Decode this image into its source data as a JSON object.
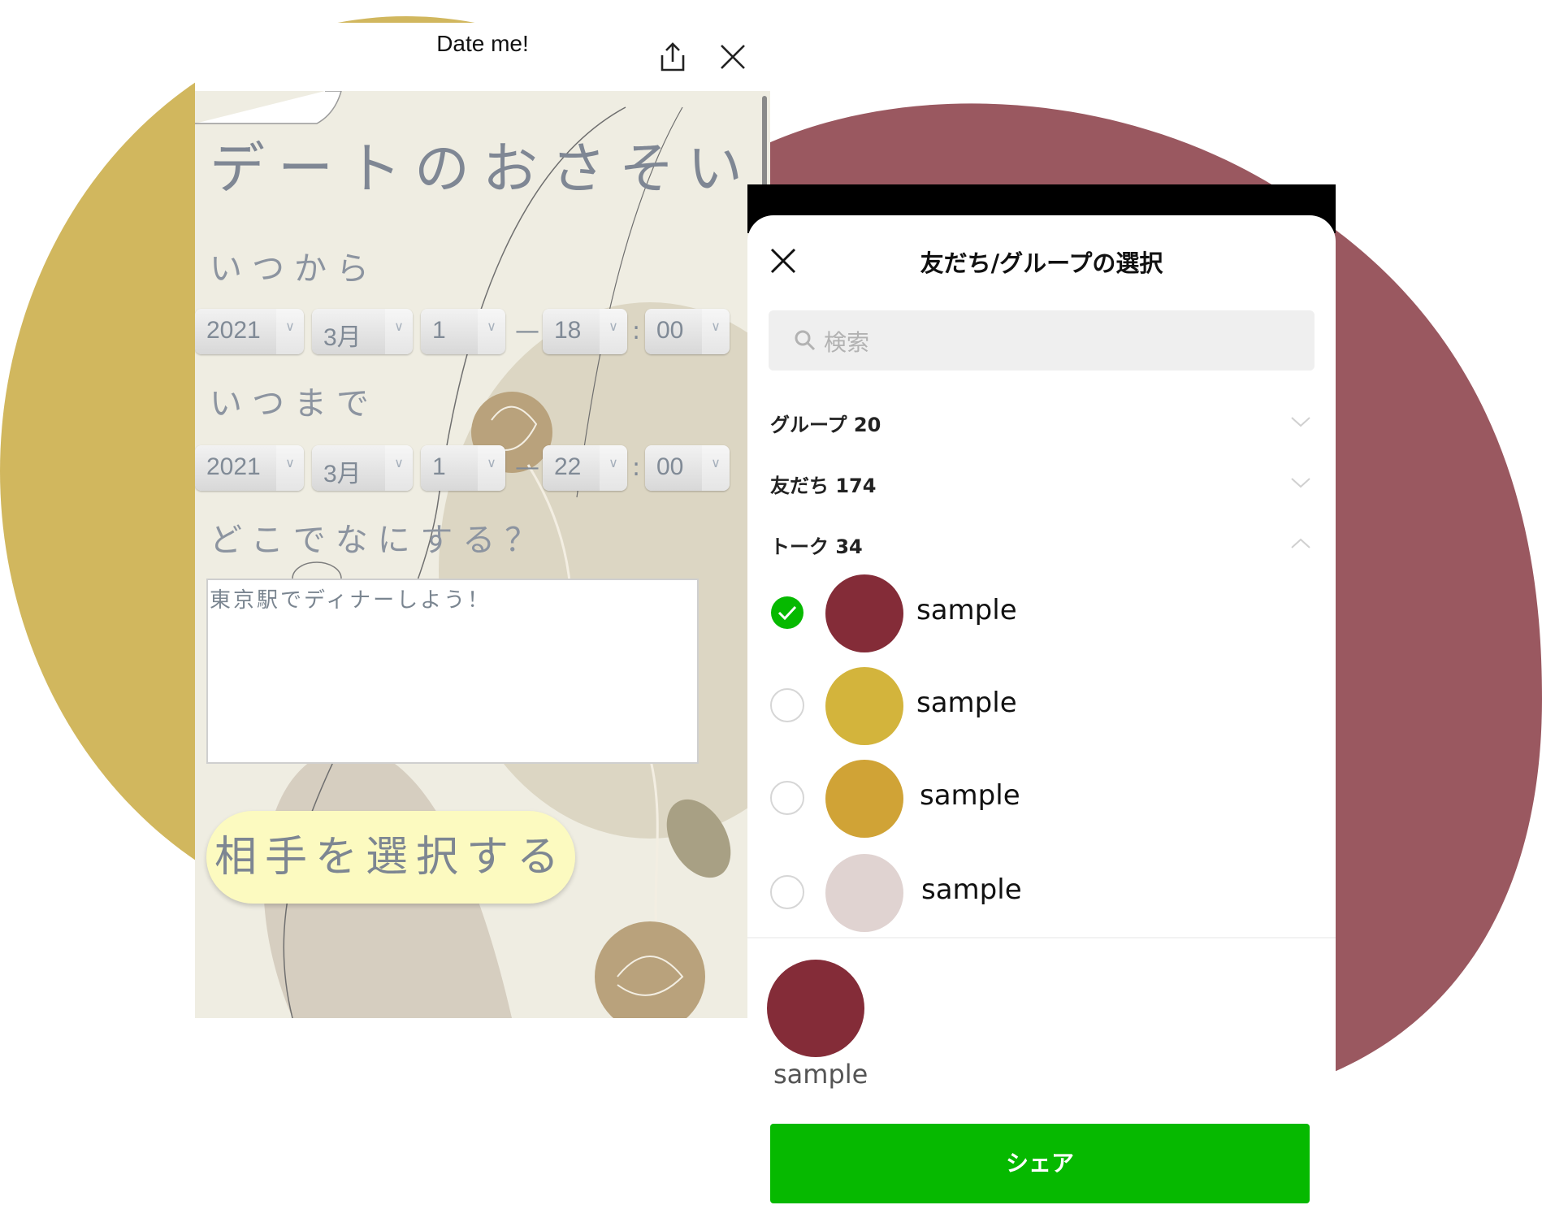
{
  "colors": {
    "mustard": "#d1b75e",
    "maroon": "#9a5860",
    "line_green": "#06b900",
    "sample_maroon": "#842c38",
    "sample_yellow": "#d3b43c",
    "sample_gold": "#d0a336",
    "sample_pink": "#e0d3d1"
  },
  "left_app": {
    "header_title": "Date me!",
    "share_icon": "share-icon",
    "close_icon": "close-icon",
    "heading": "デートのおさそい",
    "from_label": "いつから",
    "from": {
      "year": "2021",
      "month": "3月",
      "day": "1",
      "hour": "18",
      "minute": "00"
    },
    "to_label": "いつまで",
    "to": {
      "year": "2021",
      "month": "3月",
      "day": "1",
      "hour": "22",
      "minute": "00"
    },
    "dash": "—",
    "colon": ":",
    "where_label": "どこでなにする？",
    "memo_text": "東京駅でディナーしよう！",
    "choose_button": "相手を選択する"
  },
  "share_sheet": {
    "close_icon": "close-icon",
    "title": "友だち/グループの選択",
    "search_placeholder": "検索",
    "categories": [
      {
        "label": "グループ 20",
        "icon": "chevron-down-icon"
      },
      {
        "label": "友だち 174",
        "icon": "chevron-down-icon"
      },
      {
        "label": "トーク 34",
        "icon": "chevron-up-icon"
      }
    ],
    "items": [
      {
        "name": "sample",
        "checked": true,
        "color": "#842c38"
      },
      {
        "name": "sample",
        "checked": false,
        "color": "#d3b43c"
      },
      {
        "name": "sample",
        "checked": false,
        "color": "#d0a336"
      },
      {
        "name": "sample",
        "checked": false,
        "color": "#e0d3d1"
      }
    ],
    "selected": {
      "name": "sample",
      "color": "#842c38"
    },
    "share_button": "シェア"
  }
}
